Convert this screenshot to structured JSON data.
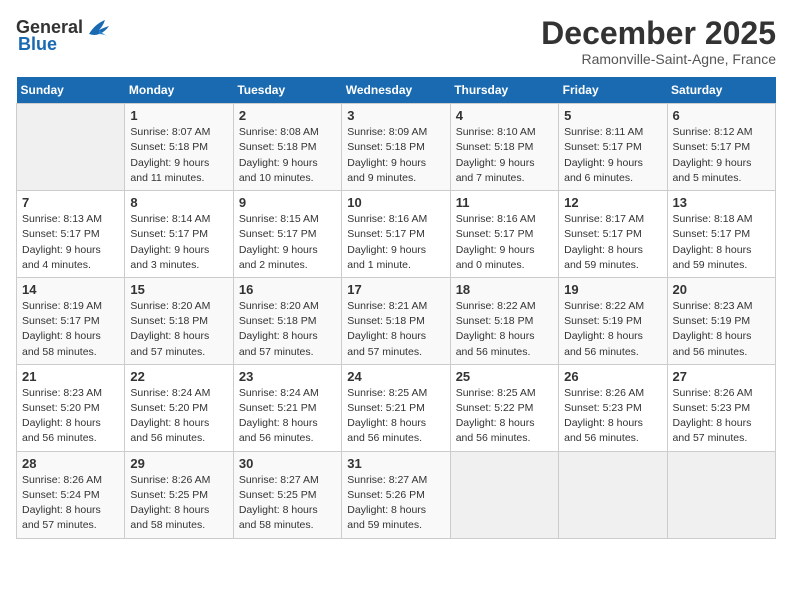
{
  "logo": {
    "text_general": "General",
    "text_blue": "Blue",
    "tagline": ""
  },
  "title": "December 2025",
  "subtitle": "Ramonville-Saint-Agne, France",
  "days_of_week": [
    "Sunday",
    "Monday",
    "Tuesday",
    "Wednesday",
    "Thursday",
    "Friday",
    "Saturday"
  ],
  "weeks": [
    [
      {
        "day": "",
        "info": ""
      },
      {
        "day": "1",
        "info": "Sunrise: 8:07 AM\nSunset: 5:18 PM\nDaylight: 9 hours\nand 11 minutes."
      },
      {
        "day": "2",
        "info": "Sunrise: 8:08 AM\nSunset: 5:18 PM\nDaylight: 9 hours\nand 10 minutes."
      },
      {
        "day": "3",
        "info": "Sunrise: 8:09 AM\nSunset: 5:18 PM\nDaylight: 9 hours\nand 9 minutes."
      },
      {
        "day": "4",
        "info": "Sunrise: 8:10 AM\nSunset: 5:18 PM\nDaylight: 9 hours\nand 7 minutes."
      },
      {
        "day": "5",
        "info": "Sunrise: 8:11 AM\nSunset: 5:17 PM\nDaylight: 9 hours\nand 6 minutes."
      },
      {
        "day": "6",
        "info": "Sunrise: 8:12 AM\nSunset: 5:17 PM\nDaylight: 9 hours\nand 5 minutes."
      }
    ],
    [
      {
        "day": "7",
        "info": "Sunrise: 8:13 AM\nSunset: 5:17 PM\nDaylight: 9 hours\nand 4 minutes."
      },
      {
        "day": "8",
        "info": "Sunrise: 8:14 AM\nSunset: 5:17 PM\nDaylight: 9 hours\nand 3 minutes."
      },
      {
        "day": "9",
        "info": "Sunrise: 8:15 AM\nSunset: 5:17 PM\nDaylight: 9 hours\nand 2 minutes."
      },
      {
        "day": "10",
        "info": "Sunrise: 8:16 AM\nSunset: 5:17 PM\nDaylight: 9 hours\nand 1 minute."
      },
      {
        "day": "11",
        "info": "Sunrise: 8:16 AM\nSunset: 5:17 PM\nDaylight: 9 hours\nand 0 minutes."
      },
      {
        "day": "12",
        "info": "Sunrise: 8:17 AM\nSunset: 5:17 PM\nDaylight: 8 hours\nand 59 minutes."
      },
      {
        "day": "13",
        "info": "Sunrise: 8:18 AM\nSunset: 5:17 PM\nDaylight: 8 hours\nand 59 minutes."
      }
    ],
    [
      {
        "day": "14",
        "info": "Sunrise: 8:19 AM\nSunset: 5:17 PM\nDaylight: 8 hours\nand 58 minutes."
      },
      {
        "day": "15",
        "info": "Sunrise: 8:20 AM\nSunset: 5:18 PM\nDaylight: 8 hours\nand 57 minutes."
      },
      {
        "day": "16",
        "info": "Sunrise: 8:20 AM\nSunset: 5:18 PM\nDaylight: 8 hours\nand 57 minutes."
      },
      {
        "day": "17",
        "info": "Sunrise: 8:21 AM\nSunset: 5:18 PM\nDaylight: 8 hours\nand 57 minutes."
      },
      {
        "day": "18",
        "info": "Sunrise: 8:22 AM\nSunset: 5:18 PM\nDaylight: 8 hours\nand 56 minutes."
      },
      {
        "day": "19",
        "info": "Sunrise: 8:22 AM\nSunset: 5:19 PM\nDaylight: 8 hours\nand 56 minutes."
      },
      {
        "day": "20",
        "info": "Sunrise: 8:23 AM\nSunset: 5:19 PM\nDaylight: 8 hours\nand 56 minutes."
      }
    ],
    [
      {
        "day": "21",
        "info": "Sunrise: 8:23 AM\nSunset: 5:20 PM\nDaylight: 8 hours\nand 56 minutes."
      },
      {
        "day": "22",
        "info": "Sunrise: 8:24 AM\nSunset: 5:20 PM\nDaylight: 8 hours\nand 56 minutes."
      },
      {
        "day": "23",
        "info": "Sunrise: 8:24 AM\nSunset: 5:21 PM\nDaylight: 8 hours\nand 56 minutes."
      },
      {
        "day": "24",
        "info": "Sunrise: 8:25 AM\nSunset: 5:21 PM\nDaylight: 8 hours\nand 56 minutes."
      },
      {
        "day": "25",
        "info": "Sunrise: 8:25 AM\nSunset: 5:22 PM\nDaylight: 8 hours\nand 56 minutes."
      },
      {
        "day": "26",
        "info": "Sunrise: 8:26 AM\nSunset: 5:23 PM\nDaylight: 8 hours\nand 56 minutes."
      },
      {
        "day": "27",
        "info": "Sunrise: 8:26 AM\nSunset: 5:23 PM\nDaylight: 8 hours\nand 57 minutes."
      }
    ],
    [
      {
        "day": "28",
        "info": "Sunrise: 8:26 AM\nSunset: 5:24 PM\nDaylight: 8 hours\nand 57 minutes."
      },
      {
        "day": "29",
        "info": "Sunrise: 8:26 AM\nSunset: 5:25 PM\nDaylight: 8 hours\nand 58 minutes."
      },
      {
        "day": "30",
        "info": "Sunrise: 8:27 AM\nSunset: 5:25 PM\nDaylight: 8 hours\nand 58 minutes."
      },
      {
        "day": "31",
        "info": "Sunrise: 8:27 AM\nSunset: 5:26 PM\nDaylight: 8 hours\nand 59 minutes."
      },
      {
        "day": "",
        "info": ""
      },
      {
        "day": "",
        "info": ""
      },
      {
        "day": "",
        "info": ""
      }
    ]
  ]
}
